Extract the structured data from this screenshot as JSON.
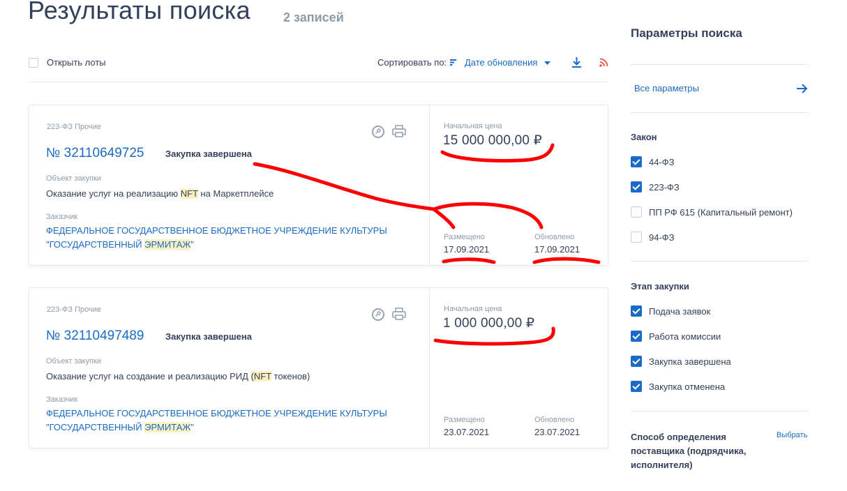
{
  "header": {
    "title": "Результаты поиска",
    "count": "2 записей"
  },
  "toolbar": {
    "open_lots": "Открыть лоты",
    "sort_label": "Сортировать по:",
    "sort_value": "Дате обновления"
  },
  "results": [
    {
      "law": "223-ФЗ Прочие",
      "number": "№ 32110649725",
      "status": "Закупка завершена",
      "object_label": "Объект закупки",
      "object_before": "Оказание услуг на реализацию ",
      "object_highlight": "NFT",
      "object_after": " на Маркетплейсе",
      "customer_label": "Заказчик",
      "customer_line1": "ФЕДЕРАЛЬНОЕ ГОСУДАРСТВЕННОЕ БЮДЖЕТНОЕ УЧРЕЖДЕНИЕ КУЛЬТУРЫ",
      "customer_line2_before": "\"ГОСУДАРСТВЕННЫЙ ",
      "customer_line2_highlight": "ЭРМИТАЖ",
      "customer_line2_after": "\"",
      "price_label": "Начальная цена",
      "price": "15 000 000,00 ₽",
      "placed_label": "Размещено",
      "placed": "17.09.2021",
      "updated_label": "Обновлено",
      "updated": "17.09.2021"
    },
    {
      "law": "223-ФЗ Прочие",
      "number": "№ 32110497489",
      "status": "Закупка завершена",
      "object_label": "Объект закупки",
      "object_before": "Оказание услуг на создание и реализацию РИД ",
      "object_highlight": "(NFT",
      "object_after": " токенов)",
      "customer_label": "Заказчик",
      "customer_line1": "ФЕДЕРАЛЬНОЕ ГОСУДАРСТВЕННОЕ БЮДЖЕТНОЕ УЧРЕЖДЕНИЕ КУЛЬТУРЫ",
      "customer_line2_before": "\"ГОСУДАРСТВЕННЫЙ ",
      "customer_line2_highlight": "ЭРМИТАЖ",
      "customer_line2_after": "\"",
      "price_label": "Начальная цена",
      "price": "1 000 000,00 ₽",
      "placed_label": "Размещено",
      "placed": "23.07.2021",
      "updated_label": "Обновлено",
      "updated": "23.07.2021"
    }
  ],
  "sidebar": {
    "title": "Параметры поиска",
    "all_params": "Все параметры",
    "law_heading": "Закон",
    "laws": [
      {
        "label": "44-ФЗ",
        "checked": true
      },
      {
        "label": "223-ФЗ",
        "checked": true
      },
      {
        "label": "ПП РФ 615 (Капитальный ремонт)",
        "checked": false
      },
      {
        "label": "94-ФЗ",
        "checked": false
      }
    ],
    "stage_heading": "Этап закупки",
    "stages": [
      {
        "label": "Подача заявок",
        "checked": true
      },
      {
        "label": "Работа комиссии",
        "checked": true
      },
      {
        "label": "Закупка завершена",
        "checked": true
      },
      {
        "label": "Закупка отменена",
        "checked": true
      }
    ],
    "method_line1": "Способ определения",
    "method_line2": "поставщика (подрядчика,",
    "method_line3": "исполнителя)",
    "method_select": "Выбрать"
  },
  "colors": {
    "accent": "#1a6bc7",
    "text": "#334059",
    "muted": "#8d9aa8",
    "rss": "#e2553e",
    "annotation": "#ff0000",
    "highlight": "#fdf1c2"
  }
}
